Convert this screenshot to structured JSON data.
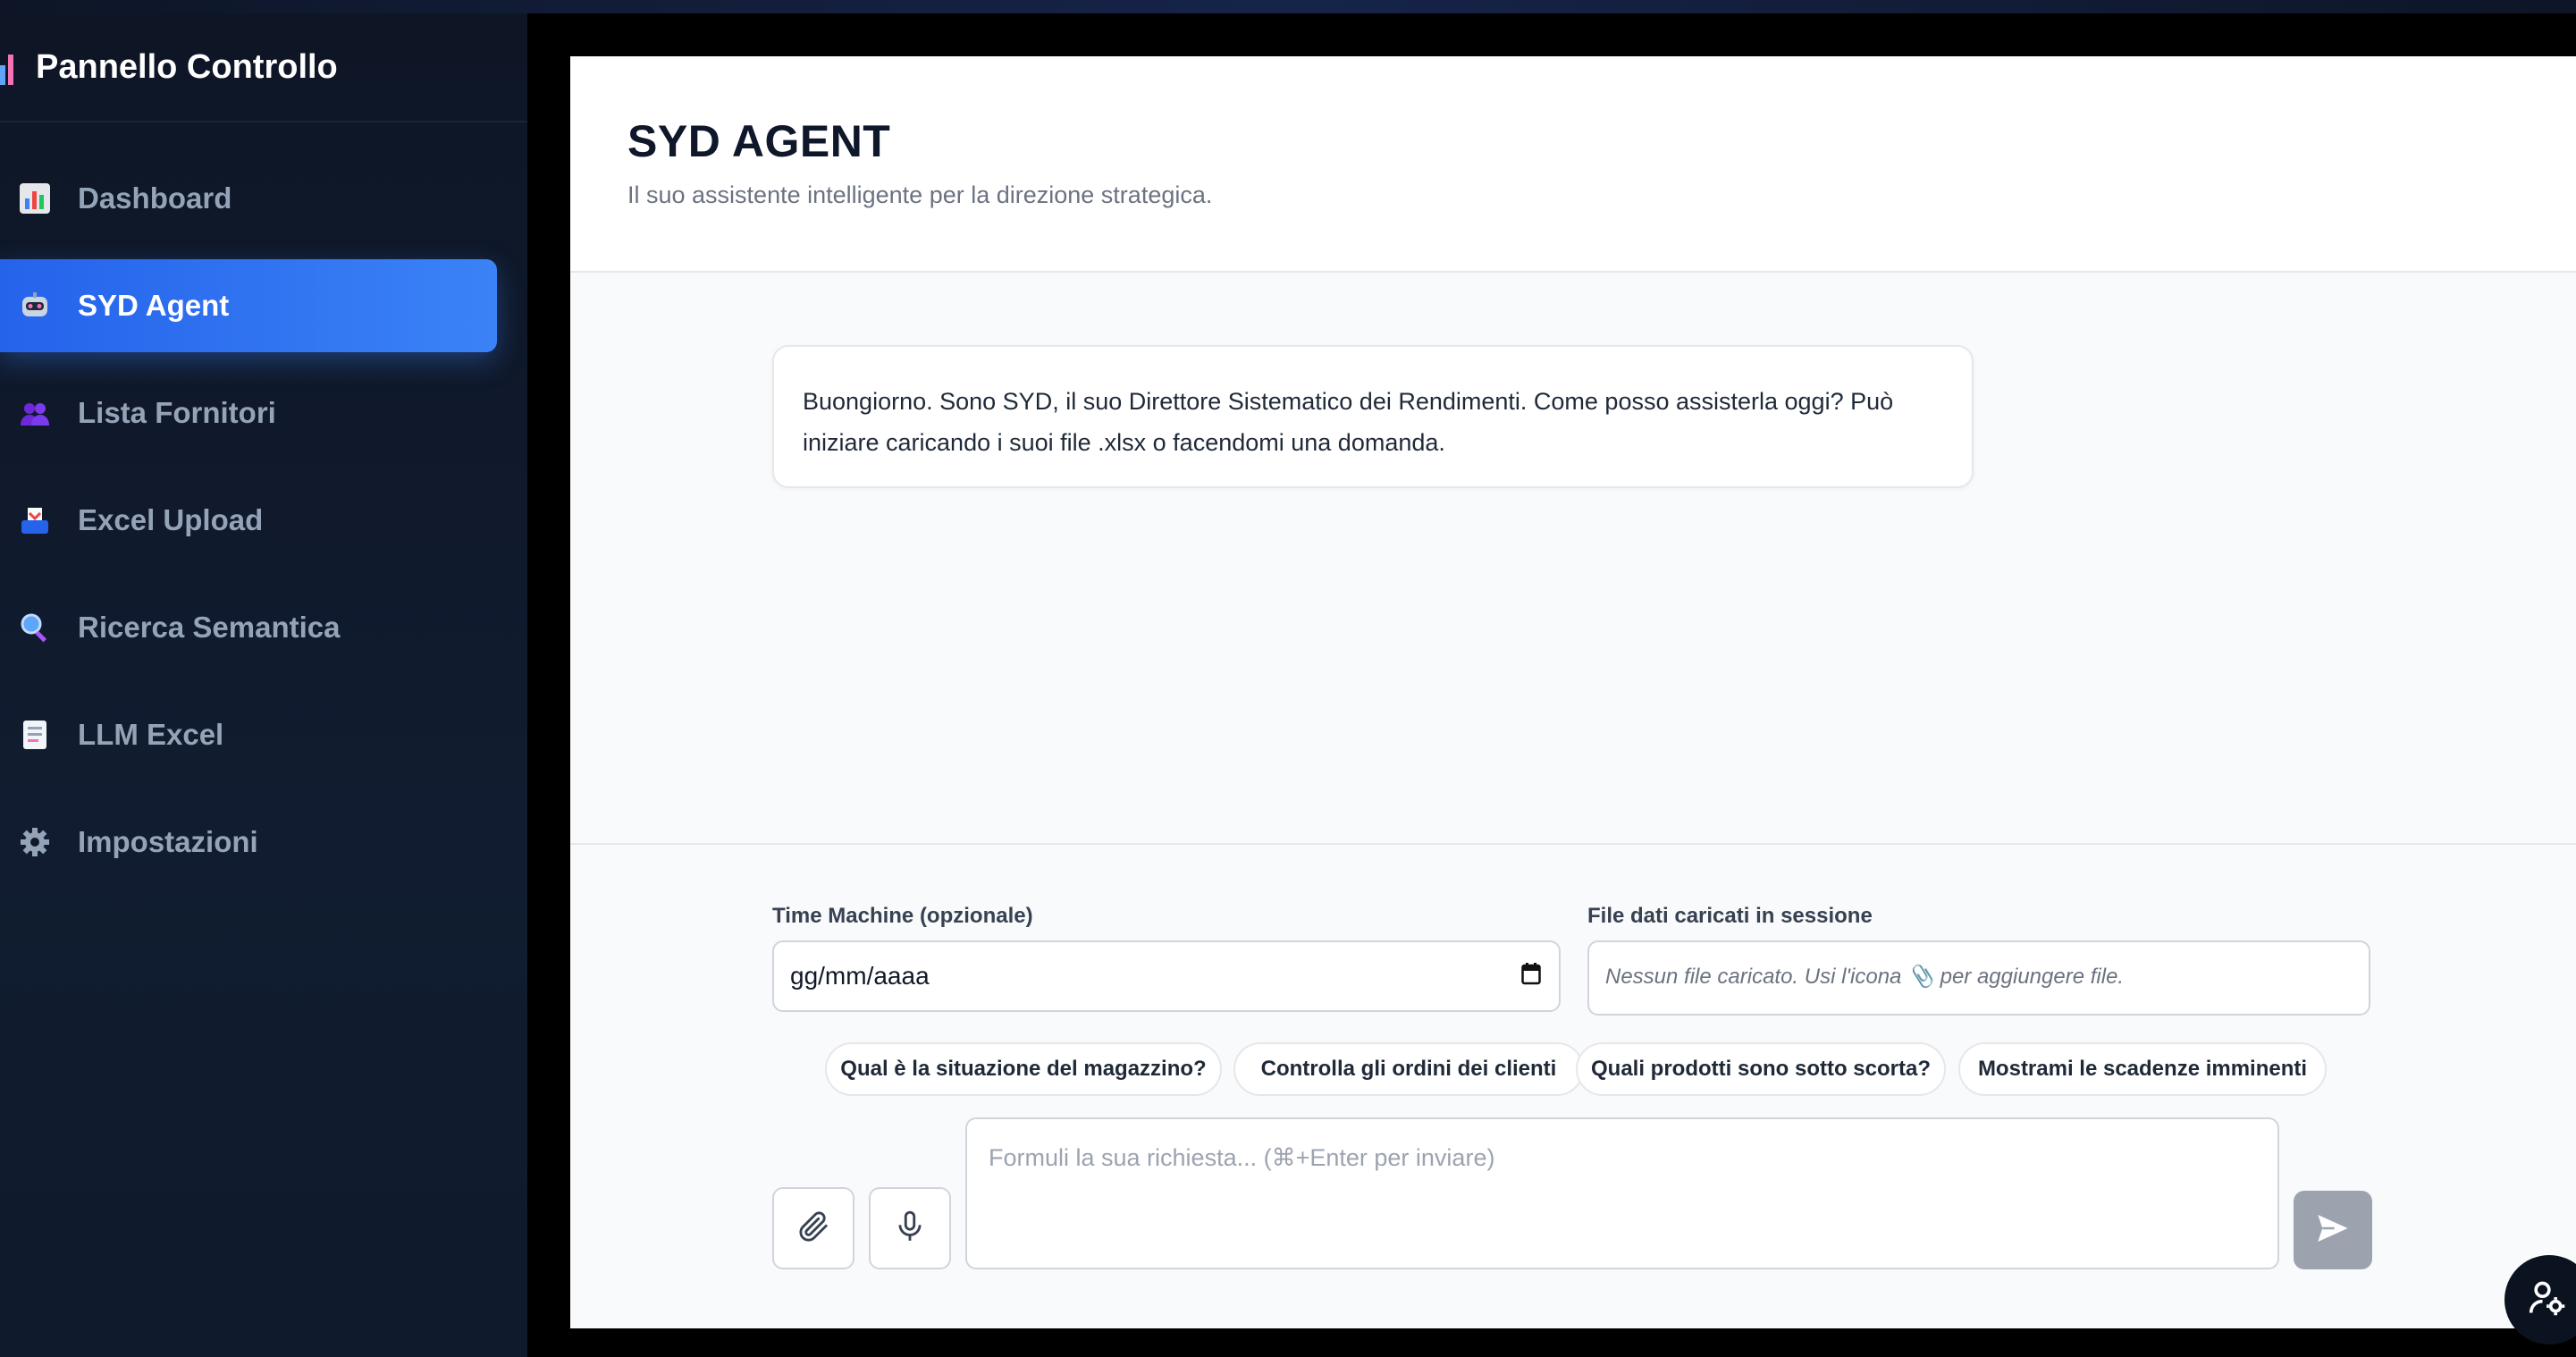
{
  "sidebar": {
    "title": "Pannello Controllo",
    "items": [
      {
        "label": "Dashboard",
        "icon": "bar-chart-icon"
      },
      {
        "label": "SYD Agent",
        "icon": "robot-icon",
        "active": true
      },
      {
        "label": "Lista Fornitori",
        "icon": "users-icon"
      },
      {
        "label": "Excel Upload",
        "icon": "inbox-tray-icon"
      },
      {
        "label": "Ricerca Semantica",
        "icon": "magnifier-icon"
      },
      {
        "label": "LLM Excel",
        "icon": "document-icon"
      },
      {
        "label": "Impostazioni",
        "icon": "gear-icon"
      }
    ]
  },
  "header": {
    "title": "SYD AGENT",
    "subtitle": "Il suo assistente intelligente per la direzione strategica."
  },
  "chat": {
    "messages": [
      {
        "role": "assistant",
        "text": "Buongiorno. Sono SYD, il suo Direttore Sistematico dei Rendimenti. Come posso assisterla oggi? Può iniziare caricando i suoi file .xlsx o facendomi una domanda."
      }
    ]
  },
  "controls": {
    "time_machine_label": "Time Machine (opzionale)",
    "date_value": "gg/mm/aaaa",
    "files_label": "File dati caricati in sessione",
    "files_text": "Nessun file caricato. Usi l'icona 📎 per aggiungere file.",
    "suggestions": [
      "Qual è la situazione del magazzino?",
      "Controlla gli ordini dei clienti",
      "Quali prodotti sono sotto scorta?",
      "Mostrami le scadenze imminenti"
    ],
    "input_placeholder": "Formuli la sua richiesta... (⌘+Enter per inviare)"
  },
  "colors": {
    "accent": "#3b82f6",
    "sidebar_bg": "#111827",
    "send_disabled": "#9ca3af"
  }
}
